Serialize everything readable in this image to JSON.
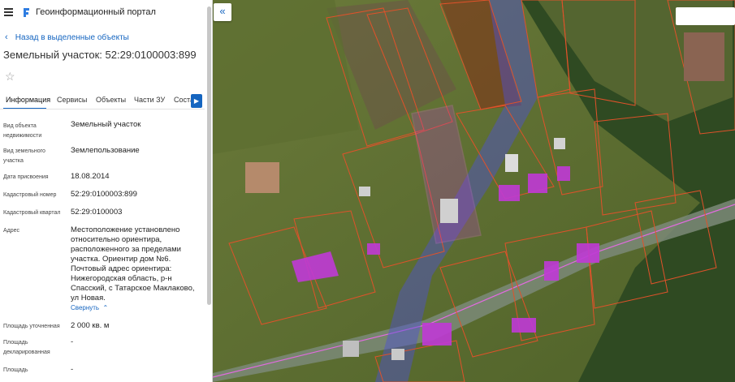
{
  "header": {
    "app_title": "Геоинформационный портал",
    "menu_icon": "hamburger-icon",
    "logo_icon": "portal-logo-icon"
  },
  "nav": {
    "back_label": "Назад в выделенные объекты"
  },
  "object": {
    "title": "Земельный участок: 52:29:0100003:899"
  },
  "tabs": [
    {
      "label": "Информация",
      "active": true
    },
    {
      "label": "Сервисы",
      "active": false
    },
    {
      "label": "Объекты",
      "active": false
    },
    {
      "label": "Части ЗУ",
      "active": false
    },
    {
      "label": "Соста",
      "active": false
    }
  ],
  "info": {
    "rows": [
      {
        "label": "Вид объекта недвижимости",
        "value": "Земельный участок"
      },
      {
        "label": "Вид земельного участка",
        "value": "Землепользование"
      },
      {
        "label": "Дата присвоения",
        "value": "18.08.2014"
      },
      {
        "label": "Кадастровый номер",
        "value": "52:29:0100003:899"
      },
      {
        "label": "Кадастровый квартал",
        "value": "52:29:0100003"
      },
      {
        "label": "Адрес",
        "value": "Местоположение установлено относительно ориентира, расположенного за пределами участка. Ориентир дом №6. Почтовый адрес ориентира: Нижегородская область, р-н Спасский, с Татарское Маклаково, ул Новая."
      },
      {
        "label": "Площадь уточненная",
        "value": "2 000 кв. м"
      },
      {
        "label": "Площадь декларированная",
        "value": "-"
      },
      {
        "label": "Площадь",
        "value": "-"
      }
    ],
    "collapse_label": "Свернуть"
  },
  "map": {
    "search_placeholder": "",
    "collapse_icon": "double-chevron-left-icon",
    "colors": {
      "parcel_outline": "#e0522a",
      "building_fill": "#c03ad6",
      "zone_fill": "#4e4fd8",
      "selected_outline": "#e26be0"
    }
  }
}
